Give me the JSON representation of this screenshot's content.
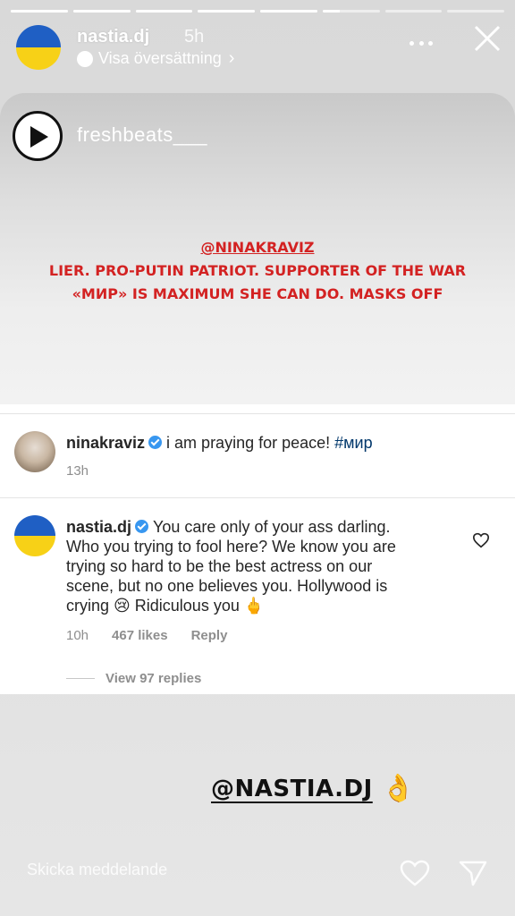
{
  "story": {
    "progress_segments": [
      1,
      1,
      1,
      1,
      1,
      0.3,
      0,
      0
    ],
    "username": "nastia.dj",
    "time": "5h",
    "translate_label": "Visa översättning"
  },
  "shared_post": {
    "music_label": "freshbeats___",
    "lines": [
      "@NINAKRAVIZ",
      "LIER. PRO-PUTIN PATRIOT. SUPPORTER OF THE WAR",
      "«МИР» IS MAXIMUM SHE CAN DO. MASKS OFF"
    ]
  },
  "comments": {
    "first": {
      "username": "ninakraviz",
      "text": "i am praying for peace! ",
      "hashtag": "#мир",
      "time": "13h"
    },
    "second": {
      "username": "nastia.dj",
      "text_lines": [
        "You care only of your ass darling.",
        "Who you trying to fool here? We know you are",
        "trying so hard to be the best actress on our",
        "scene, but no one believes you. Hollywood is",
        "crying 😢 Ridiculous you 🖕"
      ],
      "time": "10h",
      "likes": "467 likes",
      "reply_label": "Reply"
    },
    "view_replies": "View 97 replies"
  },
  "sticker": {
    "mention": "@NASTIA.DJ",
    "emoji": "👌"
  },
  "reply_bar": {
    "placeholder": "Skicka meddelande"
  },
  "colors": {
    "accent_red": "#d32222",
    "flag_blue": "#1f5fc4",
    "flag_yellow": "#f7d117",
    "verified_blue": "#3897f0"
  }
}
